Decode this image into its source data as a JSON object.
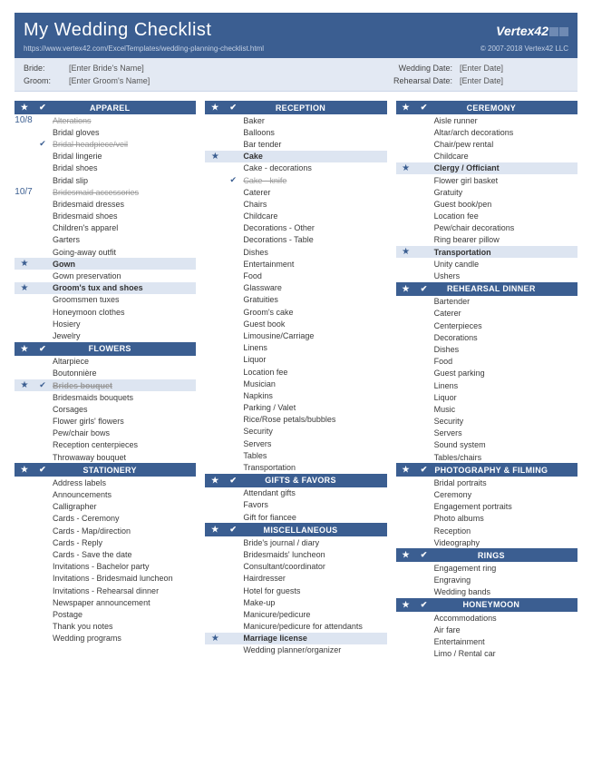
{
  "header": {
    "title": "My Wedding Checklist",
    "logo": "Vertex42",
    "url": "https://www.vertex42.com/ExcelTemplates/wedding-planning-checklist.html",
    "copyright": "© 2007-2018 Vertex42 LLC"
  },
  "meta": {
    "bride_label": "Bride:",
    "bride_value": "[Enter Bride's Name]",
    "groom_label": "Groom:",
    "groom_value": "[Enter Groom's Name]",
    "wedding_date_label": "Wedding Date:",
    "wedding_date_value": "[Enter Date]",
    "rehearsal_date_label": "Rehearsal Date:",
    "rehearsal_date_value": "[Enter Date]"
  },
  "columns": [
    {
      "sections": [
        {
          "title": "APPAREL",
          "star": true,
          "items": [
            {
              "text": "Alterations",
              "done": true,
              "date": "10/8"
            },
            {
              "text": "Bridal gloves"
            },
            {
              "text": "Bridal headpiece/veil",
              "done": true,
              "check": true
            },
            {
              "text": "Bridal lingerie"
            },
            {
              "text": "Bridal shoes"
            },
            {
              "text": "Bridal slip"
            },
            {
              "text": "Bridesmaid accessories",
              "done": true,
              "date": "10/7"
            },
            {
              "text": "Bridesmaid dresses"
            },
            {
              "text": "Bridesmaid shoes"
            },
            {
              "text": "Children's apparel"
            },
            {
              "text": "Garters"
            },
            {
              "text": "Going-away outfit"
            },
            {
              "text": "Gown",
              "hl": true,
              "star": true
            },
            {
              "text": "Gown preservation"
            },
            {
              "text": "Groom's tux and shoes",
              "hl": true,
              "star": true
            },
            {
              "text": "Groomsmen tuxes"
            },
            {
              "text": "Honeymoon clothes"
            },
            {
              "text": "Hosiery"
            },
            {
              "text": "Jewelry"
            }
          ]
        },
        {
          "title": "FLOWERS",
          "star": true,
          "items": [
            {
              "text": "Altarpiece"
            },
            {
              "text": "Boutonnière"
            },
            {
              "text": "Brides bouquet",
              "hl": true,
              "star": true,
              "check": true,
              "done": true
            },
            {
              "text": "Bridesmaids bouquets"
            },
            {
              "text": "Corsages"
            },
            {
              "text": "Flower girls' flowers"
            },
            {
              "text": "Pew/chair bows"
            },
            {
              "text": "Reception centerpieces"
            },
            {
              "text": "Throwaway bouquet"
            }
          ]
        },
        {
          "title": "STATIONERY",
          "star": true,
          "items": [
            {
              "text": "Address labels"
            },
            {
              "text": "Announcements"
            },
            {
              "text": "Calligrapher"
            },
            {
              "text": "Cards - Ceremony"
            },
            {
              "text": "Cards - Map/direction"
            },
            {
              "text": "Cards - Reply"
            },
            {
              "text": "Cards - Save the date"
            },
            {
              "text": "Invitations - Bachelor party"
            },
            {
              "text": "Invitations - Bridesmaid luncheon"
            },
            {
              "text": "Invitations - Rehearsal dinner"
            },
            {
              "text": "Newspaper announcement"
            },
            {
              "text": "Postage"
            },
            {
              "text": "Thank you notes"
            },
            {
              "text": "Wedding programs"
            }
          ]
        }
      ]
    },
    {
      "sections": [
        {
          "title": "RECEPTION",
          "star": true,
          "items": [
            {
              "text": "Baker"
            },
            {
              "text": "Balloons"
            },
            {
              "text": "Bar tender"
            },
            {
              "text": "Cake",
              "hl": true,
              "star": true
            },
            {
              "text": "Cake - decorations"
            },
            {
              "text": "Cake - knife",
              "done": true,
              "check": true
            },
            {
              "text": "Caterer"
            },
            {
              "text": "Chairs"
            },
            {
              "text": "Childcare"
            },
            {
              "text": "Decorations - Other"
            },
            {
              "text": "Decorations - Table"
            },
            {
              "text": "Dishes"
            },
            {
              "text": "Entertainment"
            },
            {
              "text": "Food"
            },
            {
              "text": "Glassware"
            },
            {
              "text": "Gratuities"
            },
            {
              "text": "Groom's cake"
            },
            {
              "text": "Guest book"
            },
            {
              "text": "Limousine/Carriage"
            },
            {
              "text": "Linens"
            },
            {
              "text": "Liquor"
            },
            {
              "text": "Location fee"
            },
            {
              "text": "Musician"
            },
            {
              "text": "Napkins"
            },
            {
              "text": "Parking / Valet"
            },
            {
              "text": "Rice/Rose petals/bubbles"
            },
            {
              "text": "Security"
            },
            {
              "text": "Servers"
            },
            {
              "text": "Tables"
            },
            {
              "text": "Transportation"
            }
          ]
        },
        {
          "title": "GIFTS & FAVORS",
          "star": true,
          "items": [
            {
              "text": "Attendant gifts"
            },
            {
              "text": "Favors"
            },
            {
              "text": "Gift for fiancee"
            }
          ]
        },
        {
          "title": "MISCELLANEOUS",
          "star": true,
          "items": [
            {
              "text": "Bride's journal / diary"
            },
            {
              "text": "Bridesmaids' luncheon"
            },
            {
              "text": "Consultant/coordinator"
            },
            {
              "text": "Hairdresser"
            },
            {
              "text": "Hotel for guests"
            },
            {
              "text": "Make-up"
            },
            {
              "text": "Manicure/pedicure"
            },
            {
              "text": "Manicure/pedicure for attendants"
            },
            {
              "text": "Marriage license",
              "hl": true,
              "star": true
            },
            {
              "text": "Wedding planner/organizer"
            }
          ]
        }
      ]
    },
    {
      "sections": [
        {
          "title": "CEREMONY",
          "star": true,
          "items": [
            {
              "text": "Aisle runner"
            },
            {
              "text": "Altar/arch decorations"
            },
            {
              "text": "Chair/pew rental"
            },
            {
              "text": "Childcare"
            },
            {
              "text": "Clergy / Officiant",
              "hl": true,
              "star": true
            },
            {
              "text": "Flower girl basket"
            },
            {
              "text": "Gratuity"
            },
            {
              "text": "Guest book/pen"
            },
            {
              "text": "Location fee"
            },
            {
              "text": "Pew/chair decorations"
            },
            {
              "text": "Ring bearer pillow"
            },
            {
              "text": "Transportation",
              "hl": true,
              "star": true
            },
            {
              "text": "Unity candle"
            },
            {
              "text": "Ushers"
            }
          ]
        },
        {
          "title": "REHEARSAL DINNER",
          "star": true,
          "items": [
            {
              "text": "Bartender"
            },
            {
              "text": "Caterer"
            },
            {
              "text": "Centerpieces"
            },
            {
              "text": "Decorations"
            },
            {
              "text": "Dishes"
            },
            {
              "text": "Food"
            },
            {
              "text": "Guest parking"
            },
            {
              "text": "Linens"
            },
            {
              "text": "Liquor"
            },
            {
              "text": "Music"
            },
            {
              "text": "Security"
            },
            {
              "text": "Servers"
            },
            {
              "text": "Sound system"
            },
            {
              "text": "Tables/chairs"
            }
          ]
        },
        {
          "title": "PHOTOGRAPHY & FILMING",
          "star": true,
          "items": [
            {
              "text": "Bridal portraits"
            },
            {
              "text": "Ceremony"
            },
            {
              "text": "Engagement portraits"
            },
            {
              "text": "Photo albums"
            },
            {
              "text": "Reception"
            },
            {
              "text": "Videography"
            }
          ]
        },
        {
          "title": "RINGS",
          "star": true,
          "items": [
            {
              "text": "Engagement ring"
            },
            {
              "text": "Engraving"
            },
            {
              "text": "Wedding bands"
            }
          ]
        },
        {
          "title": "HONEYMOON",
          "star": true,
          "items": [
            {
              "text": "Accommodations"
            },
            {
              "text": "Air fare"
            },
            {
              "text": "Entertainment"
            },
            {
              "text": "Limo / Rental car"
            }
          ]
        }
      ]
    }
  ]
}
